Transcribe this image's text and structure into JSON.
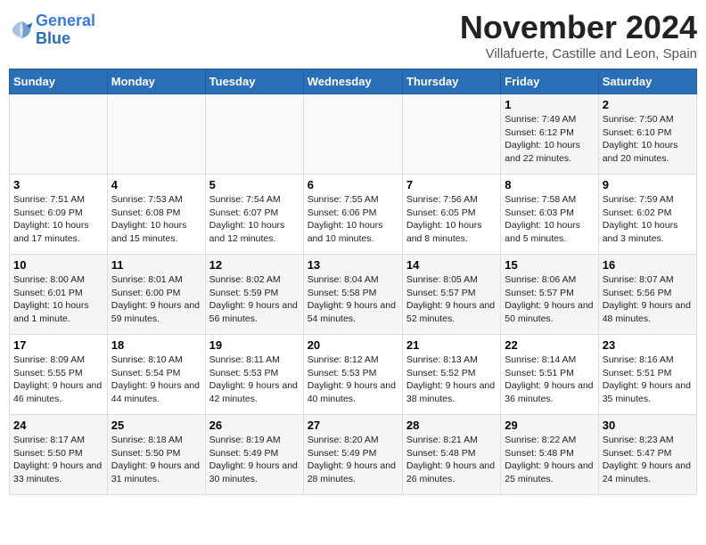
{
  "header": {
    "logo_line1": "General",
    "logo_line2": "Blue",
    "month": "November 2024",
    "location": "Villafuerte, Castille and Leon, Spain"
  },
  "weekdays": [
    "Sunday",
    "Monday",
    "Tuesday",
    "Wednesday",
    "Thursday",
    "Friday",
    "Saturday"
  ],
  "weeks": [
    [
      {
        "day": "",
        "info": ""
      },
      {
        "day": "",
        "info": ""
      },
      {
        "day": "",
        "info": ""
      },
      {
        "day": "",
        "info": ""
      },
      {
        "day": "",
        "info": ""
      },
      {
        "day": "1",
        "info": "Sunrise: 7:49 AM\nSunset: 6:12 PM\nDaylight: 10 hours and 22 minutes."
      },
      {
        "day": "2",
        "info": "Sunrise: 7:50 AM\nSunset: 6:10 PM\nDaylight: 10 hours and 20 minutes."
      }
    ],
    [
      {
        "day": "3",
        "info": "Sunrise: 7:51 AM\nSunset: 6:09 PM\nDaylight: 10 hours and 17 minutes."
      },
      {
        "day": "4",
        "info": "Sunrise: 7:53 AM\nSunset: 6:08 PM\nDaylight: 10 hours and 15 minutes."
      },
      {
        "day": "5",
        "info": "Sunrise: 7:54 AM\nSunset: 6:07 PM\nDaylight: 10 hours and 12 minutes."
      },
      {
        "day": "6",
        "info": "Sunrise: 7:55 AM\nSunset: 6:06 PM\nDaylight: 10 hours and 10 minutes."
      },
      {
        "day": "7",
        "info": "Sunrise: 7:56 AM\nSunset: 6:05 PM\nDaylight: 10 hours and 8 minutes."
      },
      {
        "day": "8",
        "info": "Sunrise: 7:58 AM\nSunset: 6:03 PM\nDaylight: 10 hours and 5 minutes."
      },
      {
        "day": "9",
        "info": "Sunrise: 7:59 AM\nSunset: 6:02 PM\nDaylight: 10 hours and 3 minutes."
      }
    ],
    [
      {
        "day": "10",
        "info": "Sunrise: 8:00 AM\nSunset: 6:01 PM\nDaylight: 10 hours and 1 minute."
      },
      {
        "day": "11",
        "info": "Sunrise: 8:01 AM\nSunset: 6:00 PM\nDaylight: 9 hours and 59 minutes."
      },
      {
        "day": "12",
        "info": "Sunrise: 8:02 AM\nSunset: 5:59 PM\nDaylight: 9 hours and 56 minutes."
      },
      {
        "day": "13",
        "info": "Sunrise: 8:04 AM\nSunset: 5:58 PM\nDaylight: 9 hours and 54 minutes."
      },
      {
        "day": "14",
        "info": "Sunrise: 8:05 AM\nSunset: 5:57 PM\nDaylight: 9 hours and 52 minutes."
      },
      {
        "day": "15",
        "info": "Sunrise: 8:06 AM\nSunset: 5:57 PM\nDaylight: 9 hours and 50 minutes."
      },
      {
        "day": "16",
        "info": "Sunrise: 8:07 AM\nSunset: 5:56 PM\nDaylight: 9 hours and 48 minutes."
      }
    ],
    [
      {
        "day": "17",
        "info": "Sunrise: 8:09 AM\nSunset: 5:55 PM\nDaylight: 9 hours and 46 minutes."
      },
      {
        "day": "18",
        "info": "Sunrise: 8:10 AM\nSunset: 5:54 PM\nDaylight: 9 hours and 44 minutes."
      },
      {
        "day": "19",
        "info": "Sunrise: 8:11 AM\nSunset: 5:53 PM\nDaylight: 9 hours and 42 minutes."
      },
      {
        "day": "20",
        "info": "Sunrise: 8:12 AM\nSunset: 5:53 PM\nDaylight: 9 hours and 40 minutes."
      },
      {
        "day": "21",
        "info": "Sunrise: 8:13 AM\nSunset: 5:52 PM\nDaylight: 9 hours and 38 minutes."
      },
      {
        "day": "22",
        "info": "Sunrise: 8:14 AM\nSunset: 5:51 PM\nDaylight: 9 hours and 36 minutes."
      },
      {
        "day": "23",
        "info": "Sunrise: 8:16 AM\nSunset: 5:51 PM\nDaylight: 9 hours and 35 minutes."
      }
    ],
    [
      {
        "day": "24",
        "info": "Sunrise: 8:17 AM\nSunset: 5:50 PM\nDaylight: 9 hours and 33 minutes."
      },
      {
        "day": "25",
        "info": "Sunrise: 8:18 AM\nSunset: 5:50 PM\nDaylight: 9 hours and 31 minutes."
      },
      {
        "day": "26",
        "info": "Sunrise: 8:19 AM\nSunset: 5:49 PM\nDaylight: 9 hours and 30 minutes."
      },
      {
        "day": "27",
        "info": "Sunrise: 8:20 AM\nSunset: 5:49 PM\nDaylight: 9 hours and 28 minutes."
      },
      {
        "day": "28",
        "info": "Sunrise: 8:21 AM\nSunset: 5:48 PM\nDaylight: 9 hours and 26 minutes."
      },
      {
        "day": "29",
        "info": "Sunrise: 8:22 AM\nSunset: 5:48 PM\nDaylight: 9 hours and 25 minutes."
      },
      {
        "day": "30",
        "info": "Sunrise: 8:23 AM\nSunset: 5:47 PM\nDaylight: 9 hours and 24 minutes."
      }
    ]
  ]
}
